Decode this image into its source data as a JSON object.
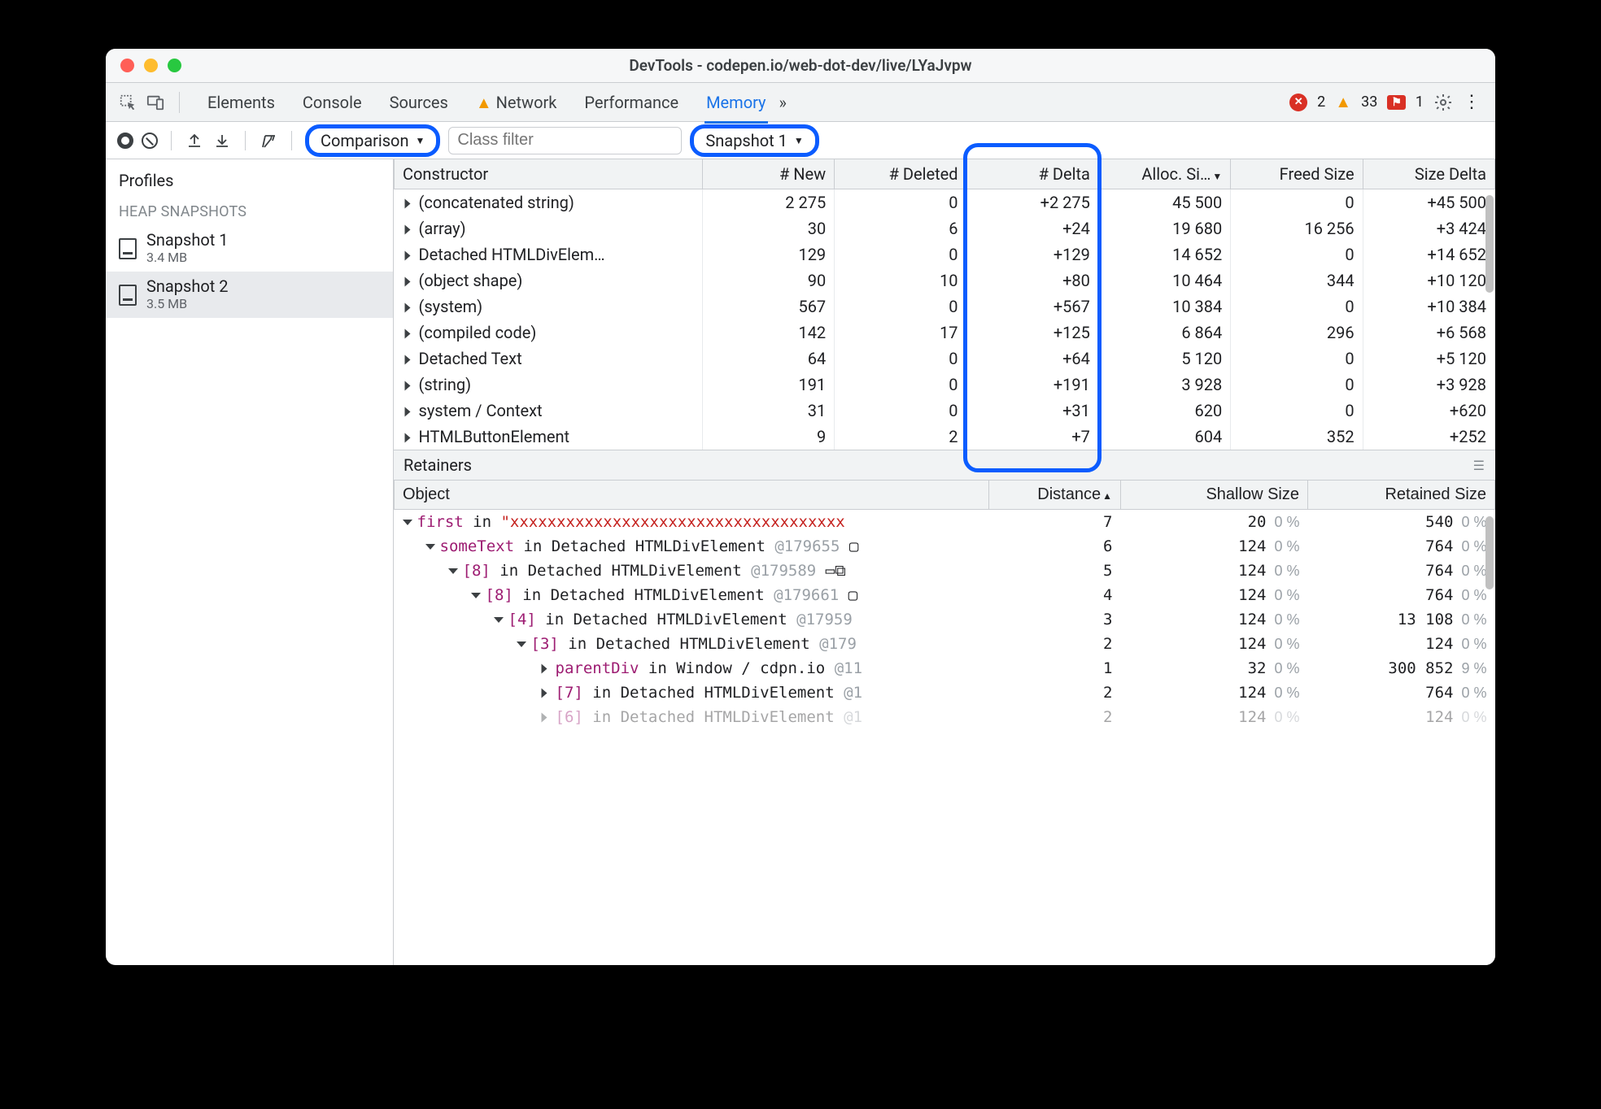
{
  "window_title": "DevTools - codepen.io/web-dot-dev/live/LYaJvpw",
  "tabs": {
    "items": [
      "Elements",
      "Console",
      "Sources",
      "Network",
      "Performance",
      "Memory"
    ],
    "network_has_warning": true,
    "active": "Memory",
    "overflow_label": "»"
  },
  "status": {
    "errors": 2,
    "warnings": 33,
    "issues": 1
  },
  "toolbar": {
    "view_dropdown": "Comparison",
    "class_filter_placeholder": "Class filter",
    "baseline_dropdown": "Snapshot 1"
  },
  "sidebar": {
    "header": "Profiles",
    "section": "HEAP SNAPSHOTS",
    "snapshots": [
      {
        "name": "Snapshot 1",
        "size": "3.4 MB",
        "selected": false
      },
      {
        "name": "Snapshot 2",
        "size": "3.5 MB",
        "selected": true
      }
    ]
  },
  "diff_table": {
    "columns": [
      "Constructor",
      "# New",
      "# Deleted",
      "# Delta",
      "Alloc. Si…",
      "Freed Size",
      "Size Delta"
    ],
    "sort_column": "Alloc. Si…",
    "rows": [
      {
        "constructor": "(concatenated string)",
        "new": "2 275",
        "deleted": "0",
        "delta": "+2 275",
        "alloc": "45 500",
        "freed": "0",
        "sdelta": "+45 500"
      },
      {
        "constructor": "(array)",
        "new": "30",
        "deleted": "6",
        "delta": "+24",
        "alloc": "19 680",
        "freed": "16 256",
        "sdelta": "+3 424"
      },
      {
        "constructor": "Detached HTMLDivElem…",
        "new": "129",
        "deleted": "0",
        "delta": "+129",
        "alloc": "14 652",
        "freed": "0",
        "sdelta": "+14 652"
      },
      {
        "constructor": "(object shape)",
        "new": "90",
        "deleted": "10",
        "delta": "+80",
        "alloc": "10 464",
        "freed": "344",
        "sdelta": "+10 120"
      },
      {
        "constructor": "(system)",
        "new": "567",
        "deleted": "0",
        "delta": "+567",
        "alloc": "10 384",
        "freed": "0",
        "sdelta": "+10 384"
      },
      {
        "constructor": "(compiled code)",
        "new": "142",
        "deleted": "17",
        "delta": "+125",
        "alloc": "6 864",
        "freed": "296",
        "sdelta": "+6 568"
      },
      {
        "constructor": "Detached Text",
        "new": "64",
        "deleted": "0",
        "delta": "+64",
        "alloc": "5 120",
        "freed": "0",
        "sdelta": "+5 120"
      },
      {
        "constructor": "(string)",
        "new": "191",
        "deleted": "0",
        "delta": "+191",
        "alloc": "3 928",
        "freed": "0",
        "sdelta": "+3 928"
      },
      {
        "constructor": "system / Context",
        "new": "31",
        "deleted": "0",
        "delta": "+31",
        "alloc": "620",
        "freed": "0",
        "sdelta": "+620"
      },
      {
        "constructor": "HTMLButtonElement",
        "new": "9",
        "deleted": "2",
        "delta": "+7",
        "alloc": "604",
        "freed": "352",
        "sdelta": "+252"
      }
    ]
  },
  "retainers": {
    "title": "Retainers",
    "columns": [
      "Object",
      "Distance",
      "Shallow Size",
      "Retained Size"
    ],
    "sort_column": "Distance",
    "rows": [
      {
        "indent": 0,
        "expanded": true,
        "prefix_html": "<span class='kw'>first</span> in <span class='str'>\"xxxxxxxxxxxxxxxxxxxxxxxxxxxxxxxxxxxx</span>",
        "distance": 7,
        "shallow": 20,
        "spct": "0 %",
        "retained": 540,
        "rpct": "0 %"
      },
      {
        "indent": 1,
        "expanded": true,
        "prefix_html": "<span class='kw'>someText</span> in <span class='mono'>Detached HTMLDivElement</span> <span class='obj-id'>@179655</span> ▢",
        "distance": 6,
        "shallow": 124,
        "spct": "0 %",
        "retained": 764,
        "rpct": "0 %"
      },
      {
        "indent": 2,
        "expanded": true,
        "prefix_html": "<span class='kw'>[8]</span> in <span class='mono'>Detached HTMLDivElement</span> <span class='obj-id'>@179589</span> ▭⧉",
        "distance": 5,
        "shallow": 124,
        "spct": "0 %",
        "retained": 764,
        "rpct": "0 %"
      },
      {
        "indent": 3,
        "expanded": true,
        "prefix_html": "<span class='kw'>[8]</span> in <span class='mono'>Detached HTMLDivElement</span> <span class='obj-id'>@179661</span> ▢",
        "distance": 4,
        "shallow": 124,
        "spct": "0 %",
        "retained": 764,
        "rpct": "0 %"
      },
      {
        "indent": 4,
        "expanded": true,
        "prefix_html": "<span class='kw'>[4]</span> in <span class='mono'>Detached HTMLDivElement</span> <span class='obj-id'>@17959</span>",
        "distance": 3,
        "shallow": 124,
        "spct": "0 %",
        "retained": "13 108",
        "rpct": "0 %"
      },
      {
        "indent": 5,
        "expanded": true,
        "prefix_html": "<span class='kw'>[3]</span> in <span class='mono'>Detached HTMLDivElement</span> <span class='obj-id'>@179</span>",
        "distance": 2,
        "shallow": 124,
        "spct": "0 %",
        "retained": 124,
        "rpct": "0 %"
      },
      {
        "indent": 6,
        "expanded": false,
        "prefix_html": "<span class='kw'>parentDiv</span> in <span class='mono'>Window / cdpn.io</span> <span class='obj-id'>@11</span>",
        "distance": 1,
        "shallow": 32,
        "spct": "0 %",
        "retained": "300 852",
        "rpct": "9 %"
      },
      {
        "indent": 6,
        "expanded": false,
        "prefix_html": "<span class='kw'>[7]</span> in <span class='mono'>Detached HTMLDivElement</span> <span class='obj-id'>@1</span>",
        "distance": 2,
        "shallow": 124,
        "spct": "0 %",
        "retained": 764,
        "rpct": "0 %"
      },
      {
        "indent": 6,
        "expanded": false,
        "fade": true,
        "prefix_html": "<span class='kw'>[6]</span> in <span class='mono'>Detached HTMLDivElement</span> <span class='obj-id'>@1</span>",
        "distance": 2,
        "shallow": 124,
        "spct": "0 %",
        "retained": 124,
        "rpct": "0 %"
      }
    ]
  }
}
